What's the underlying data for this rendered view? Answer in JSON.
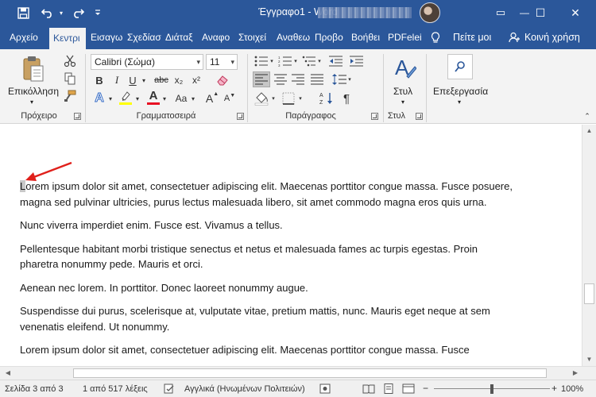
{
  "window": {
    "title": "Έγγραφο1 - Word",
    "minimize_glyph": "—",
    "maximize_glyph": "☐",
    "close_glyph": "✕",
    "ribbon_display_glyph": "▭"
  },
  "quick_access": {
    "save_icon": "save-icon",
    "undo_icon": "undo-icon",
    "redo_icon": "redo-icon",
    "customize_icon": "customize-qat-icon"
  },
  "tabs": [
    {
      "label": "Αρχείο"
    },
    {
      "label": "Κεντρι"
    },
    {
      "label": "Εισαγω"
    },
    {
      "label": "Σχεδίασ"
    },
    {
      "label": "Διάταξ"
    },
    {
      "label": "Αναφο"
    },
    {
      "label": "Στοιχεί"
    },
    {
      "label": "Αναθεω"
    },
    {
      "label": "Προβο"
    },
    {
      "label": "Βοήθει"
    },
    {
      "label": "PDFelei"
    }
  ],
  "tell_me": "Πείτε μοι",
  "share": "Κοινή χρήση",
  "ribbon": {
    "clipboard": {
      "paste_label": "Επικόλληση",
      "group_label": "Πρόχειρο"
    },
    "font": {
      "font_name": "Calibri (Σώμα)",
      "font_size": "11",
      "group_label": "Γραμματοσειρά",
      "bold": "B",
      "italic": "I",
      "underline": "U",
      "strike": "abc",
      "subscript": "x₂",
      "superscript": "x²",
      "grow": "A",
      "shrink": "A",
      "case": "Aa",
      "text_effects": "A",
      "font_color": "A"
    },
    "paragraph": {
      "group_label": "Παράγραφος",
      "pilcrow": "¶"
    },
    "styles": {
      "styles_label": "Στυλ",
      "group_label": "Στυλ"
    },
    "editing": {
      "label": "Επεξεργασία"
    }
  },
  "document": {
    "paragraphs": [
      {
        "first_char": "L",
        "rest": "orem ipsum dolor sit amet, consectetuer adipiscing elit. Maecenas porttitor congue massa. Fusce posuere, magna sed pulvinar ultricies, purus lectus malesuada libero, sit amet commodo magna eros quis urna."
      },
      {
        "text": "Nunc viverra imperdiet enim. Fusce est. Vivamus a tellus."
      },
      {
        "text": "Pellentesque habitant morbi tristique senectus et netus et malesuada fames ac turpis egestas. Proin pharetra nonummy pede. Mauris et orci."
      },
      {
        "text": "Aenean nec lorem. In porttitor. Donec laoreet nonummy augue."
      },
      {
        "text": "Suspendisse dui purus, scelerisque at, vulputate vitae, pretium mattis, nunc. Mauris eget neque at sem venenatis eleifend. Ut nonummy."
      },
      {
        "text": "Lorem ipsum dolor sit amet, consectetuer adipiscing elit. Maecenas porttitor congue massa. Fusce"
      }
    ]
  },
  "status": {
    "page": "Σελίδα 3 από 3",
    "words": "1 από 517 λέξεις",
    "language": "Αγγλικά (Ηνωμένων Πολιτειών)",
    "zoom": "100%",
    "zoom_level": 1.0
  },
  "colors": {
    "accent": "#2b579a",
    "ribbon_bg": "#f3f3f3",
    "arrow": "#e0201b",
    "highlight_yellow": "#ffff00",
    "font_color_red": "#e81123"
  }
}
